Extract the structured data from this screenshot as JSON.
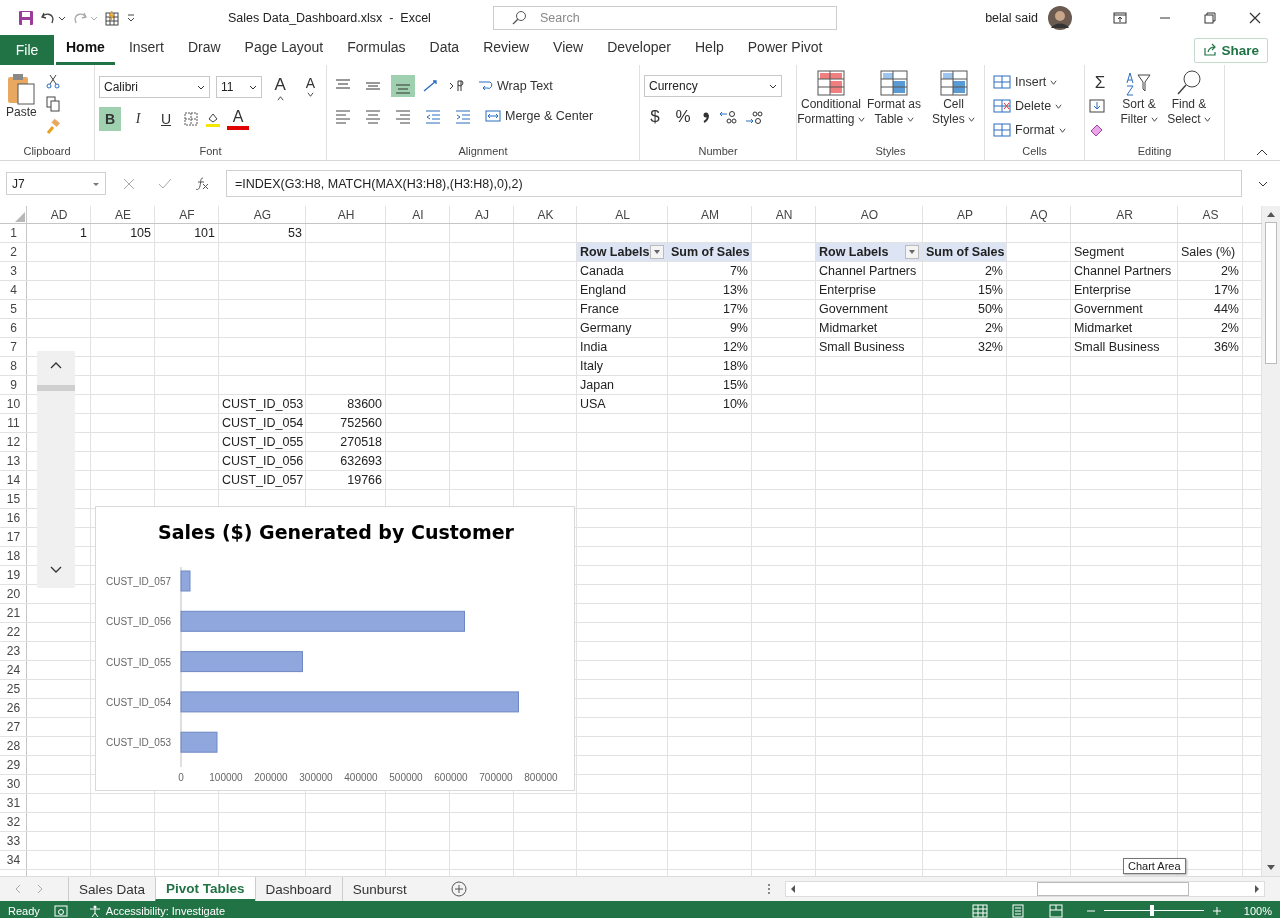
{
  "title_bar": {
    "file_name": "Sales Data_Dashboard.xlsx  -  Excel",
    "search_placeholder": "Search",
    "user_name": "belal said"
  },
  "ribbon_tabs": [
    {
      "label": "File",
      "kind": "file",
      "selected": false
    },
    {
      "label": "Home",
      "kind": "tab",
      "selected": true
    },
    {
      "label": "Insert",
      "kind": "tab",
      "selected": false
    },
    {
      "label": "Draw",
      "kind": "tab",
      "selected": false
    },
    {
      "label": "Page Layout",
      "kind": "tab",
      "selected": false
    },
    {
      "label": "Formulas",
      "kind": "tab",
      "selected": false
    },
    {
      "label": "Data",
      "kind": "tab",
      "selected": false
    },
    {
      "label": "Review",
      "kind": "tab",
      "selected": false
    },
    {
      "label": "View",
      "kind": "tab",
      "selected": false
    },
    {
      "label": "Developer",
      "kind": "tab",
      "selected": false
    },
    {
      "label": "Help",
      "kind": "tab",
      "selected": false
    },
    {
      "label": "Power Pivot",
      "kind": "tab",
      "selected": false
    }
  ],
  "share_button": "Share",
  "ribbon": {
    "clipboard": {
      "paste": "Paste",
      "label": "Clipboard"
    },
    "font": {
      "font_name": "Calibri",
      "font_size": "11",
      "grow": "A",
      "shrink": "A",
      "font_color": "A",
      "label": "Font",
      "styles": [
        {
          "label": "B",
          "kind": "bold",
          "selected": true
        },
        {
          "label": "I",
          "kind": "italic",
          "selected": false
        },
        {
          "label": "U",
          "kind": "underline",
          "selected": false
        }
      ]
    },
    "alignment": {
      "vertical": [
        {
          "kind": "top",
          "selected": false
        },
        {
          "kind": "middle",
          "selected": false
        },
        {
          "kind": "bottom",
          "selected": true
        }
      ],
      "wrap_text": "Wrap Text",
      "merge": "Merge & Center",
      "label": "Alignment"
    },
    "number": {
      "format": "Currency",
      "currency": "$",
      "percent": "%",
      "label": "Number"
    },
    "styles": {
      "buttons": [
        [
          "Conditional",
          "Formatting"
        ],
        [
          "Format as",
          "Table"
        ],
        [
          "Cell",
          "Styles"
        ]
      ],
      "label": "Styles"
    },
    "cells": {
      "buttons": [
        "Insert",
        "Delete",
        "Format"
      ],
      "label": "Cells"
    },
    "editing": {
      "sum": "Σ",
      "buttons": [
        [
          "Sort &",
          "Filter"
        ],
        [
          "Find &",
          "Select"
        ]
      ],
      "label": "Editing"
    }
  },
  "formula_bar": {
    "name_box": "J7",
    "formula": "=INDEX(G3:H8, MATCH(MAX(H3:H8),(H3:H8),0),2)"
  },
  "sheet": {
    "columns": [
      "AD",
      "AE",
      "AF",
      "AG",
      "AH",
      "AI",
      "AJ",
      "AK",
      "AL",
      "AM",
      "AN",
      "AO",
      "AP",
      "AQ",
      "AR",
      "AS"
    ],
    "row_numbers": [
      "1",
      "2",
      "3",
      "4",
      "5",
      "6",
      "7",
      "8",
      "9",
      "10",
      "11",
      "12",
      "13",
      "14",
      "15",
      "16",
      "17",
      "18",
      "19",
      "20",
      "21",
      "22",
      "23",
      "24",
      "25",
      "26",
      "27",
      "28",
      "29",
      "30",
      "31",
      "32",
      "33",
      "34"
    ],
    "top_values": [
      "1",
      "105",
      "101",
      "53"
    ],
    "customers": [
      {
        "id": "CUST_ID_053",
        "sales": "83600"
      },
      {
        "id": "CUST_ID_054",
        "sales": "752560"
      },
      {
        "id": "CUST_ID_055",
        "sales": "270518"
      },
      {
        "id": "CUST_ID_056",
        "sales": "632693"
      },
      {
        "id": "CUST_ID_057",
        "sales": "19766"
      }
    ],
    "pivot_country": {
      "headers": [
        "Row Labels",
        "Sum of Sales"
      ],
      "rows": [
        [
          "Canada",
          "7%"
        ],
        [
          "England",
          "13%"
        ],
        [
          "France",
          "17%"
        ],
        [
          "Germany",
          "9%"
        ],
        [
          "India",
          "12%"
        ],
        [
          "Italy",
          "18%"
        ],
        [
          "Japan",
          "15%"
        ],
        [
          "USA",
          "10%"
        ]
      ]
    },
    "pivot_segment": {
      "headers": [
        "Row Labels",
        "Sum of Sales"
      ],
      "rows": [
        [
          "Channel Partners",
          "2%"
        ],
        [
          "Enterprise",
          "15%"
        ],
        [
          "Government",
          "50%"
        ],
        [
          "Midmarket",
          "2%"
        ],
        [
          "Small Business",
          "32%"
        ]
      ]
    },
    "segment_table": {
      "headers": [
        "Segment",
        "Sales (%)"
      ],
      "rows": [
        [
          "Channel Partners",
          "2%"
        ],
        [
          "Enterprise",
          "17%"
        ],
        [
          "Government",
          "44%"
        ],
        [
          "Midmarket",
          "2%"
        ],
        [
          "Small Business",
          "36%"
        ]
      ]
    }
  },
  "chart": {
    "chart_data": {
      "type": "bar",
      "orientation": "horizontal",
      "title": "Sales ($) Generated by Customer",
      "categories": [
        "CUST_ID_057",
        "CUST_ID_056",
        "CUST_ID_055",
        "CUST_ID_054",
        "CUST_ID_053"
      ],
      "series": [
        {
          "color": "#8fa7dc",
          "values": [
            20000,
            630000,
            270000,
            750000,
            80000
          ]
        }
      ],
      "xlim": [
        0,
        800000
      ],
      "xticks": [
        0,
        100000,
        200000,
        300000,
        400000,
        500000,
        600000,
        700000,
        800000
      ]
    }
  },
  "tooltip": "Chart Area",
  "sheet_tabs": [
    {
      "label": "Sales Data",
      "selected": false
    },
    {
      "label": "Pivot Tables",
      "selected": true
    },
    {
      "label": "Dashboard",
      "selected": false
    },
    {
      "label": "Sunburst",
      "selected": false
    }
  ],
  "status_bar": {
    "ready": "Ready",
    "accessibility": "Accessibility: Investigate",
    "zoom": "100%"
  }
}
